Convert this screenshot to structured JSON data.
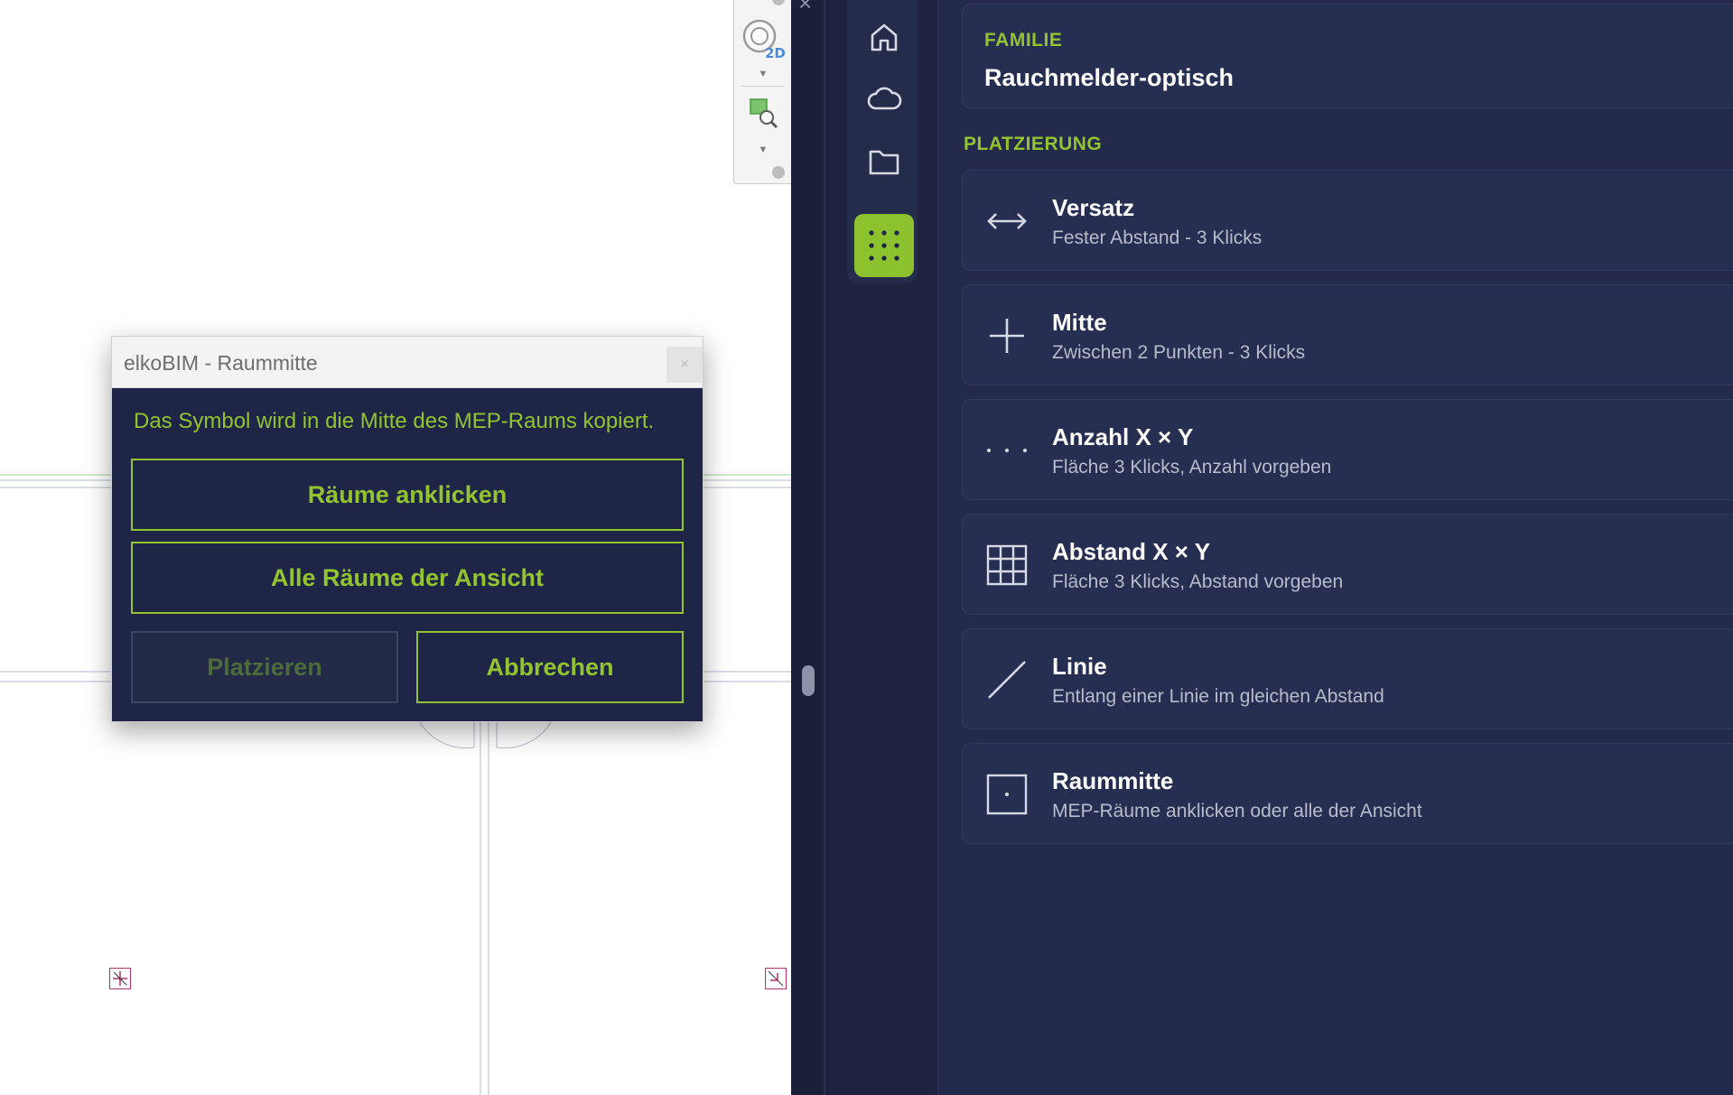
{
  "dialog": {
    "title": "elkoBIM - Raummitte",
    "close_label": "×",
    "description": "Das Symbol wird in die Mitte des MEP-Raums kopiert.",
    "btn_click_rooms": "Räume anklicken",
    "btn_all_rooms": "Alle Räume der Ansicht",
    "btn_place": "Platzieren",
    "btn_cancel": "Abbrechen"
  },
  "view_toolbar": {
    "badge_2d": "2D"
  },
  "splitter": {
    "close_label": "×"
  },
  "rail": {
    "items": [
      {
        "name": "home-icon"
      },
      {
        "name": "cloud-icon"
      },
      {
        "name": "folder-icon"
      },
      {
        "name": "grid-dots-icon",
        "active": true
      }
    ]
  },
  "panel": {
    "family_label": "FAMILIE",
    "family_value": "Rauchmelder-optisch",
    "placement_label": "PLATZIERUNG",
    "options": [
      {
        "title": "Versatz",
        "subtitle": "Fester Abstand - 3 Klicks",
        "icon": "arrows-horizontal-icon"
      },
      {
        "title": "Mitte",
        "subtitle": "Zwischen 2 Punkten - 3 Klicks",
        "icon": "plus-icon"
      },
      {
        "title": "Anzahl X × Y",
        "subtitle": "Fläche 3 Klicks, Anzahl vorgeben",
        "icon": "dots-icon"
      },
      {
        "title": "Abstand X × Y",
        "subtitle": "Fläche 3 Klicks, Abstand vorgeben",
        "icon": "grid-icon"
      },
      {
        "title": "Linie",
        "subtitle": "Entlang einer Linie im gleichen Abstand",
        "icon": "diagonal-line-icon"
      },
      {
        "title": "Raummitte",
        "subtitle": "MEP-Räume anklicken oder alle der Ansicht",
        "icon": "room-center-icon"
      }
    ]
  },
  "colors": {
    "accent": "#93c42f",
    "panel_bg": "#232a4c",
    "dialog_bg": "#1f2547"
  }
}
